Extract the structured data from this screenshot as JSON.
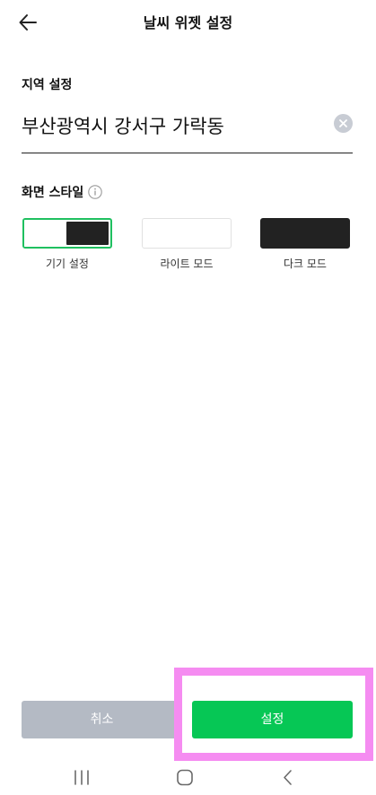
{
  "header": {
    "title": "날씨 위젯 설정"
  },
  "region": {
    "label": "지역 설정",
    "value": "부산광역시 강서구 가락동"
  },
  "screen_style": {
    "label": "화면 스타일",
    "options": [
      {
        "label": "기기 설정",
        "selected": true
      },
      {
        "label": "라이트 모드",
        "selected": false
      },
      {
        "label": "다크 모드",
        "selected": false
      }
    ]
  },
  "footer": {
    "cancel_label": "취소",
    "confirm_label": "설정"
  },
  "colors": {
    "accent": "#06c755",
    "cancel": "#b4bac4",
    "highlight": "#f58cf1",
    "dark": "#222222"
  },
  "icons": {
    "back": "back-arrow-icon",
    "clear": "clear-icon",
    "info": "info-icon",
    "nav_recents": "recents-icon",
    "nav_home": "home-icon",
    "nav_back": "nav-back-icon"
  }
}
